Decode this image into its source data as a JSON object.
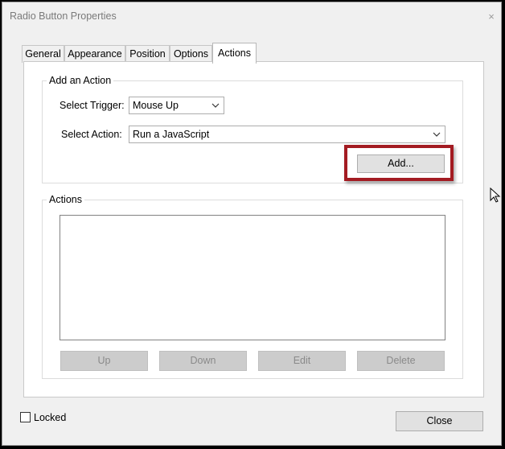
{
  "window": {
    "title": "Radio Button Properties",
    "close_glyph": "×"
  },
  "tabs": [
    {
      "label": "General",
      "active": false
    },
    {
      "label": "Appearance",
      "active": false
    },
    {
      "label": "Position",
      "active": false
    },
    {
      "label": "Options",
      "active": false
    },
    {
      "label": "Actions",
      "active": true
    }
  ],
  "add_action": {
    "group_label": "Add an Action",
    "trigger_label": "Select Trigger:",
    "trigger_value": "Mouse Up",
    "action_label": "Select Action:",
    "action_value": "Run a JavaScript",
    "add_button": "Add..."
  },
  "actions": {
    "group_label": "Actions",
    "items": [],
    "buttons": {
      "up": "Up",
      "down": "Down",
      "edit": "Edit",
      "delete": "Delete"
    }
  },
  "footer": {
    "locked_label": "Locked",
    "locked_checked": false,
    "close_button": "Close"
  },
  "colors": {
    "highlight": "#a31b22",
    "dialog_bg": "#f0f0f0",
    "panel_bg": "#ffffff"
  }
}
